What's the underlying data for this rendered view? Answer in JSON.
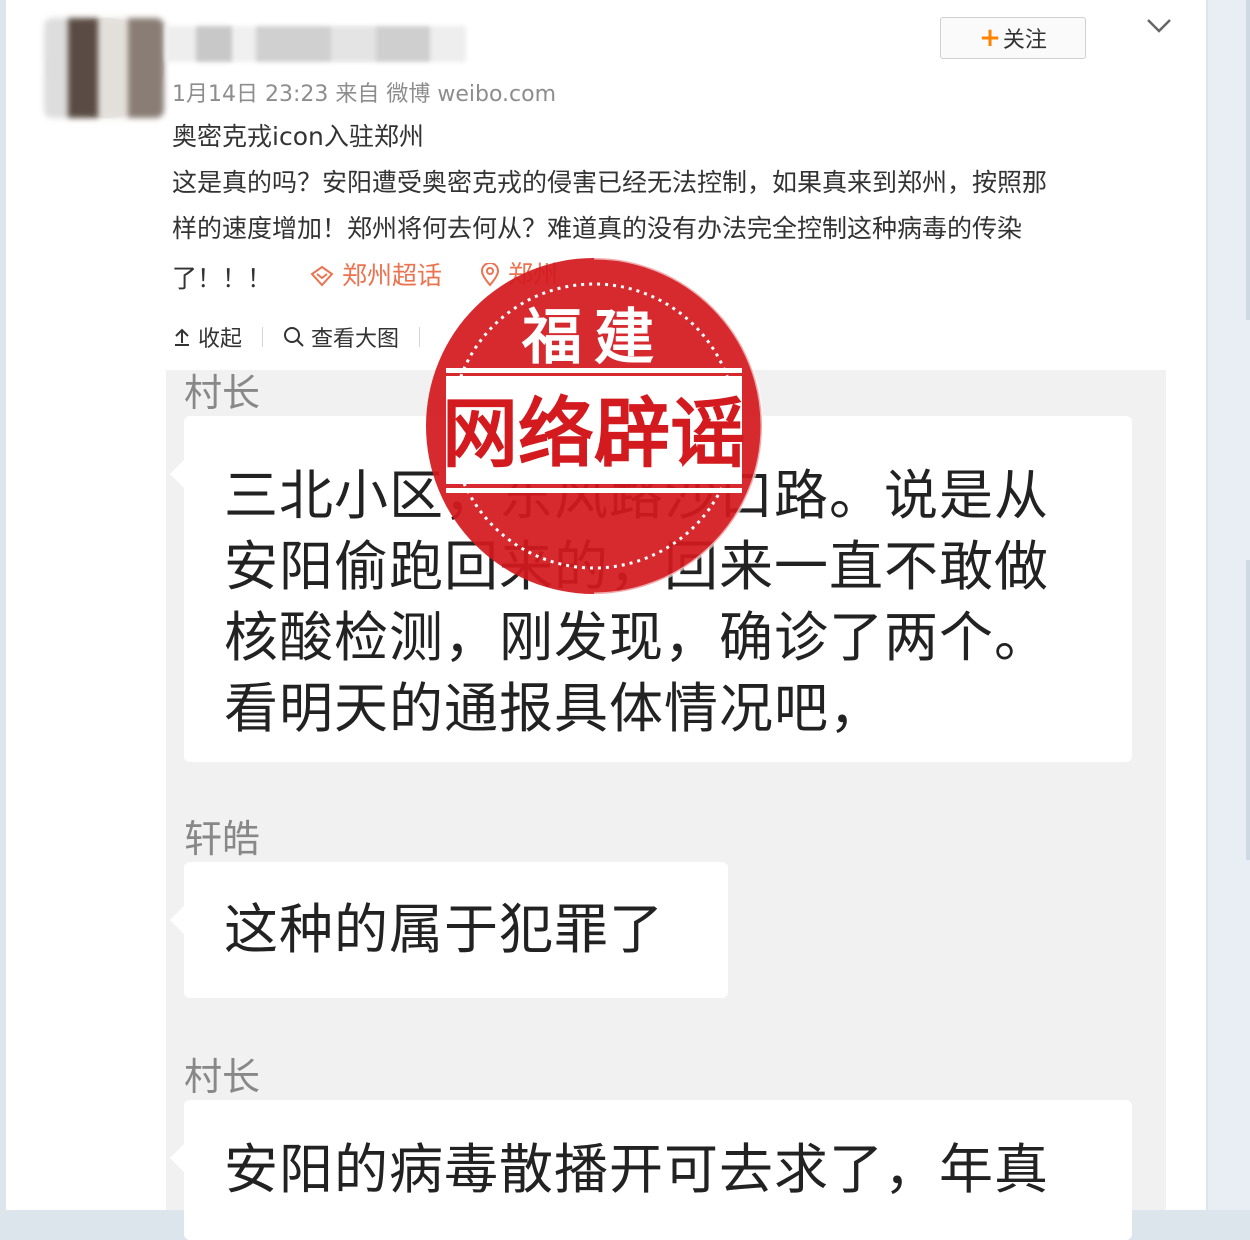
{
  "post": {
    "meta": "1月14日 23:23 来自 微博 weibo.com",
    "follow_label": "关注",
    "title": "奥密克戎icon入驻郑州",
    "body_line1": "这是真的吗？安阳遭受奥密克戎的侵害已经无法控制，如果真来到郑州，按照那",
    "body_line2": "样的速度增加！郑州将何去何从？难道真的没有办法完全控制这种病毒的传染",
    "body_line3": "了！！！",
    "topic_tag": "郑州超话",
    "location_tag": "郑州"
  },
  "actions": {
    "collapse": "收起",
    "view_large": "查看大图"
  },
  "chat": {
    "messages": [
      {
        "sender": "村长",
        "lines": [
          "三北小区，东风路沙口路。说是从",
          "安阳偷跑回来的，回来一直不敢做",
          "核酸检测，刚发现，确诊了两个。",
          "看明天的通报具体情况吧，"
        ]
      },
      {
        "sender": "轩皓",
        "lines": [
          "这种的属于犯罪了"
        ]
      },
      {
        "sender": "村长",
        "lines": [
          "安阳的病毒散播开可去求了，年真"
        ]
      }
    ]
  },
  "stamp": {
    "top_text": "福建",
    "main_text": "网络辟谣",
    "color": "#d31a1f"
  },
  "colors": {
    "accent_orange": "#ff8200",
    "tag_color": "#eb7350"
  }
}
